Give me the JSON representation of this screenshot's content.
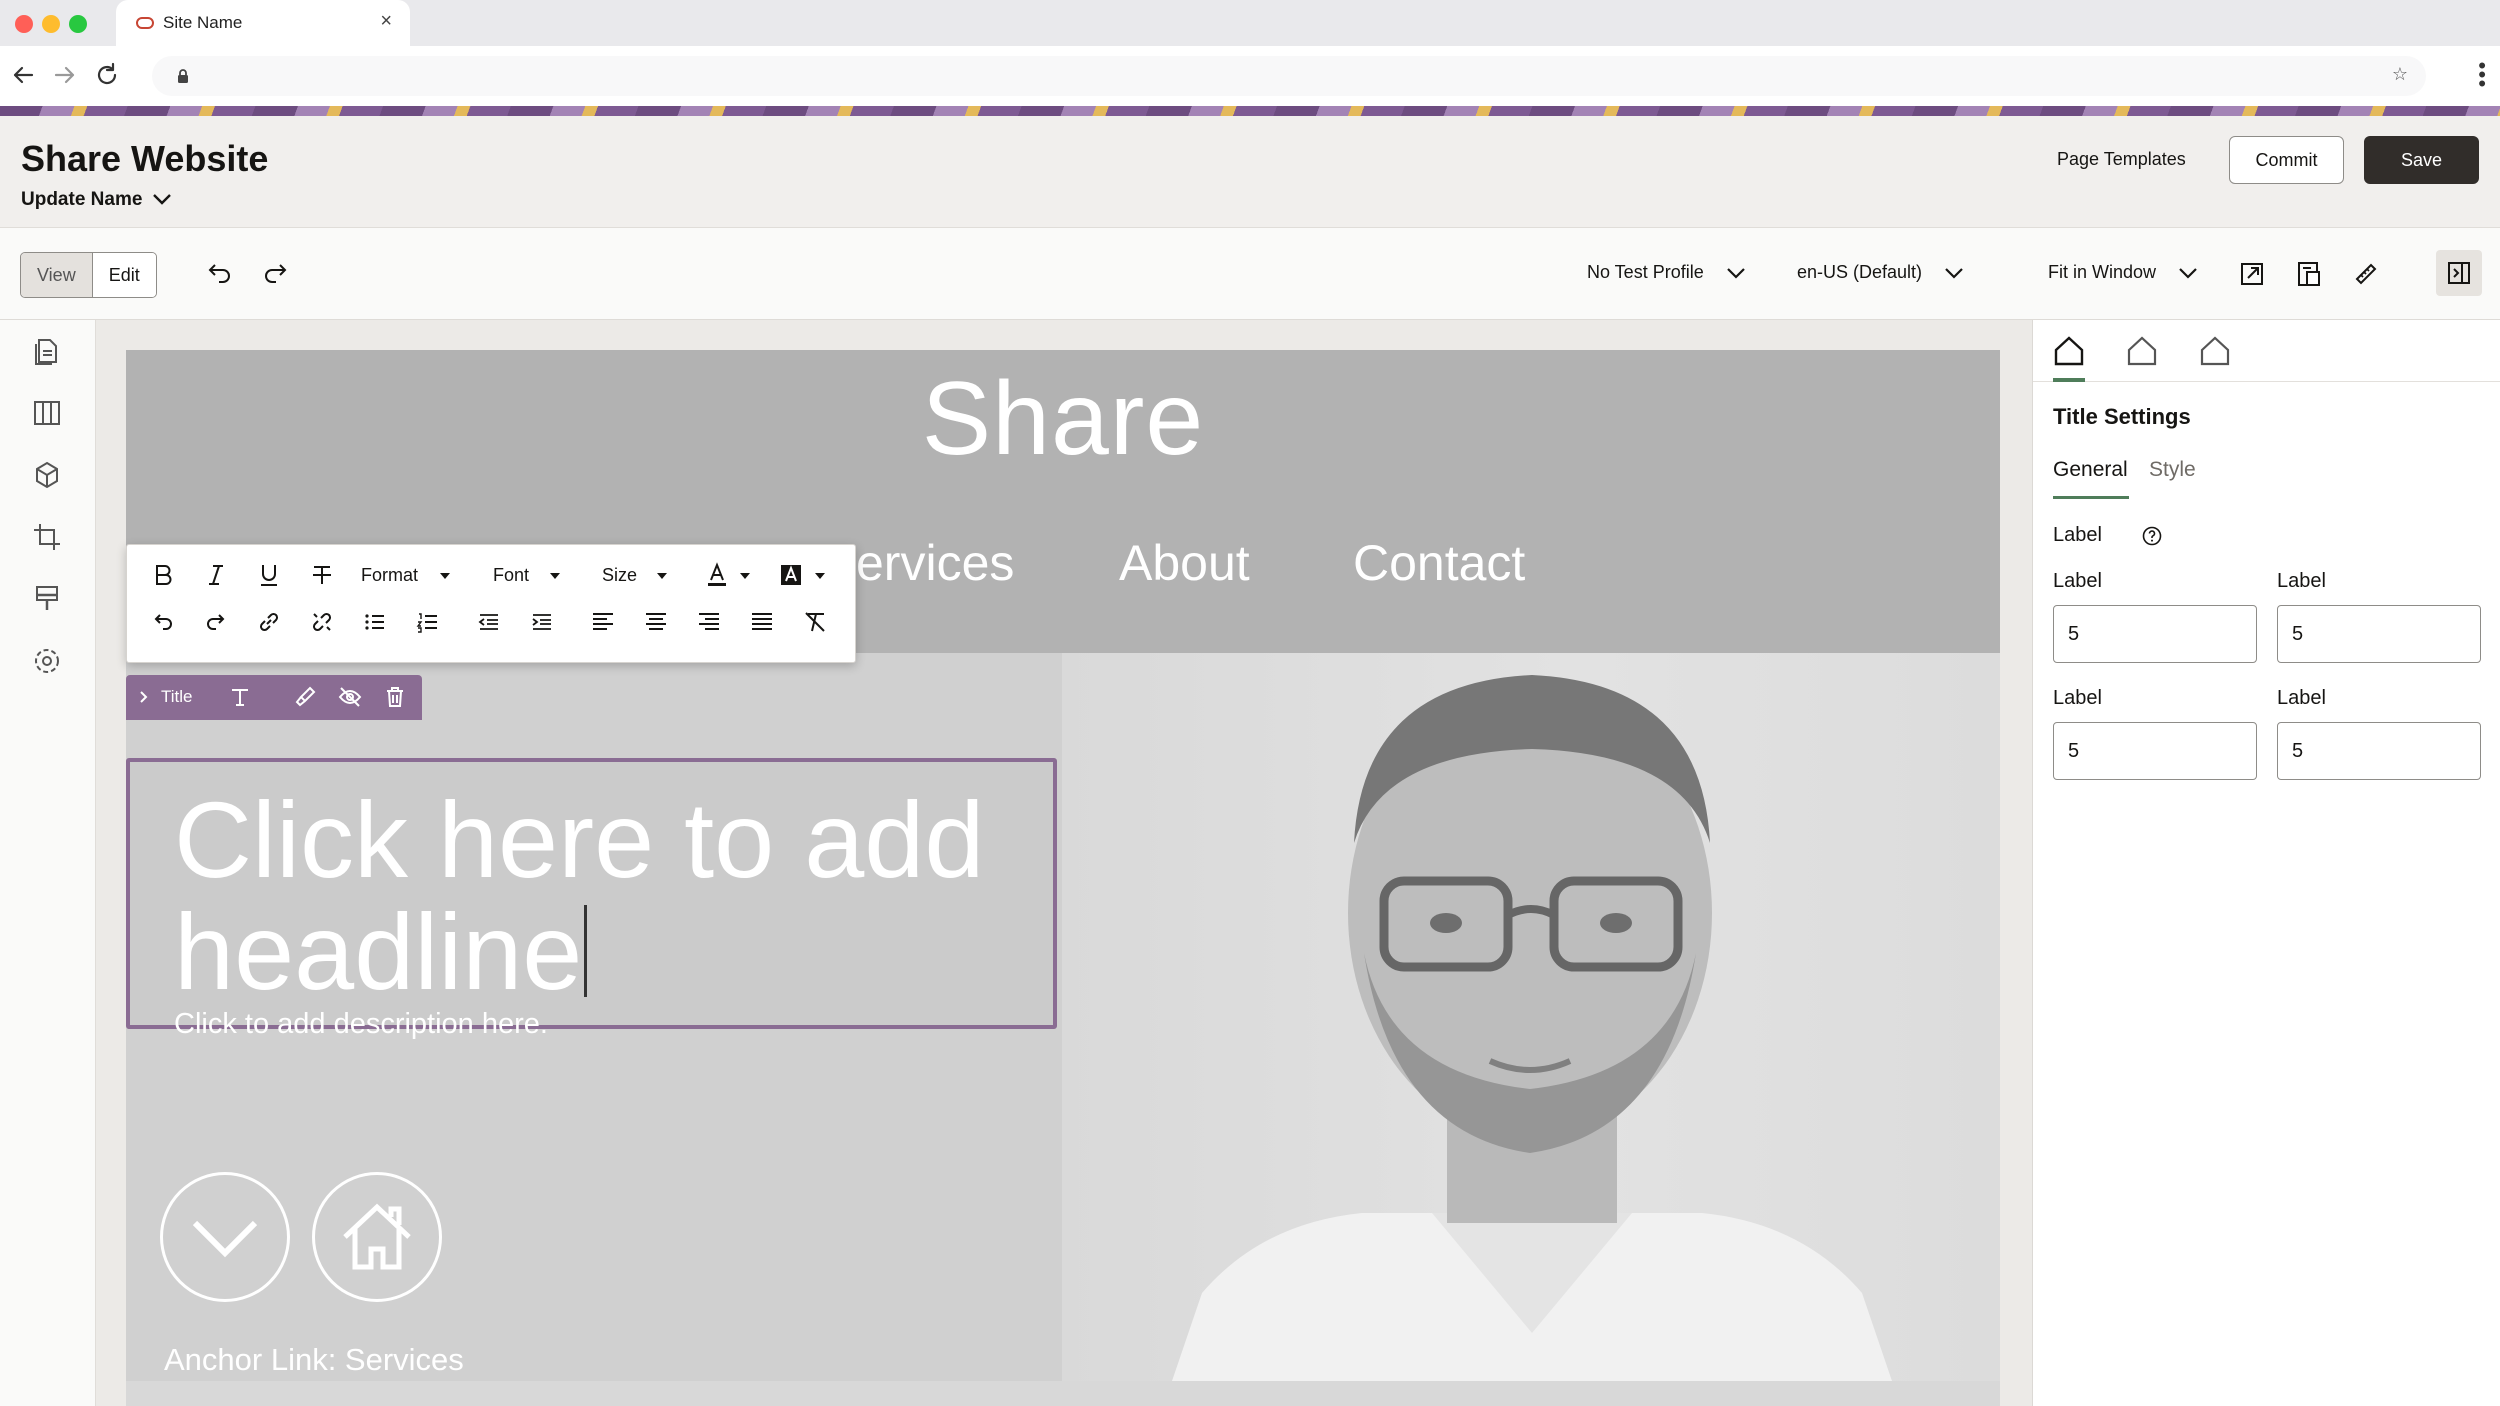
{
  "browser": {
    "tab_title": "Site Name",
    "close_symbol": "×"
  },
  "header": {
    "site_title": "Share Website",
    "update_name": "Update Name",
    "page_templates": "Page Templates",
    "commit": "Commit",
    "save": "Save"
  },
  "toolbar": {
    "view": "View",
    "edit": "Edit",
    "test_profile": "No Test Profile",
    "locale": "en-US (Default)",
    "zoom": "Fit in Window"
  },
  "site": {
    "brand": "Share",
    "nav": [
      "ervices",
      "About",
      "Contact"
    ],
    "headline_line1": "Click here to add",
    "headline_line2": "headline",
    "description": "Click to add description here.",
    "anchor_link": "Anchor Link: Services"
  },
  "rte": {
    "format": "Format",
    "font": "Font",
    "size": "Size"
  },
  "title_tab": {
    "label": "Title"
  },
  "panel": {
    "heading": "Title Settings",
    "tab_general": "General",
    "tab_style": "Style",
    "section_label": "Label",
    "fields": [
      {
        "label": "Label",
        "value": "5"
      },
      {
        "label": "Label",
        "value": "5"
      },
      {
        "label": "Label",
        "value": "5"
      },
      {
        "label": "Label",
        "value": "5"
      }
    ]
  },
  "colors": {
    "accent_purple": "#8a6c93",
    "accent_green": "#4f7d5a",
    "save_dark": "#312d2a"
  }
}
